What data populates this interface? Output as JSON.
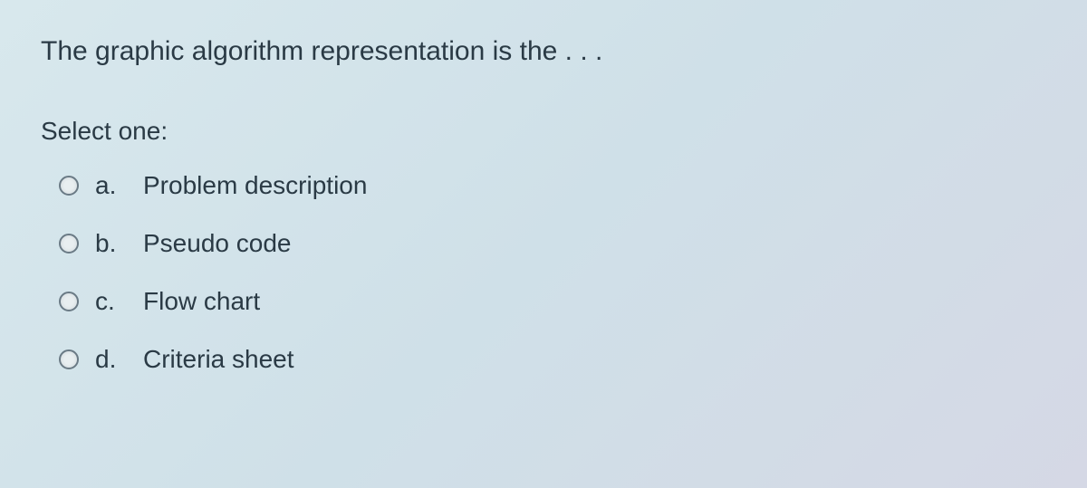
{
  "question": {
    "text": "The graphic algorithm representation is the . . .",
    "select_label": "Select one:",
    "options": [
      {
        "letter": "a.",
        "text": "Problem description"
      },
      {
        "letter": "b.",
        "text": "Pseudo code"
      },
      {
        "letter": "c.",
        "text": "Flow chart"
      },
      {
        "letter": "d.",
        "text": "Criteria sheet"
      }
    ]
  }
}
